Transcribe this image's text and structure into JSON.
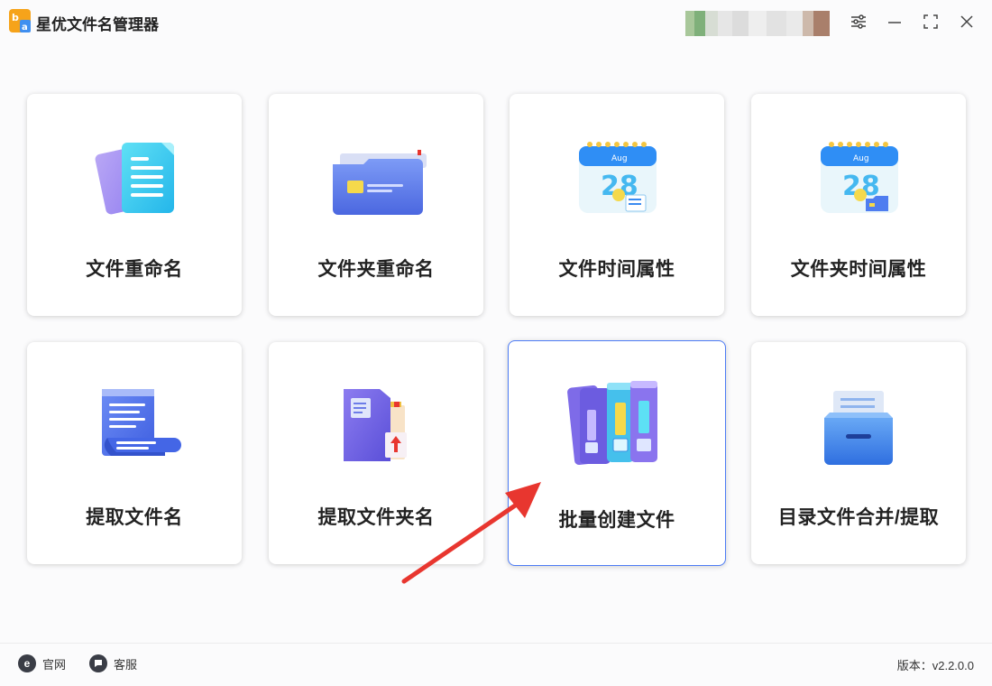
{
  "app": {
    "title": "星优文件名管理器",
    "logo_icon": "app-logo-icon"
  },
  "window_controls": {
    "settings_icon": "sliders-icon",
    "minimize_icon": "minimize-icon",
    "maximize_icon": "maximize-icon",
    "close_icon": "close-icon"
  },
  "cards": [
    {
      "label": "文件重命名",
      "icon": "document-stack-icon"
    },
    {
      "label": "文件夹重命名",
      "icon": "folder-icon"
    },
    {
      "label": "文件时间属性",
      "icon": "calendar-icon"
    },
    {
      "label": "文件夹时间属性",
      "icon": "calendar-folder-icon"
    },
    {
      "label": "提取文件名",
      "icon": "scroll-document-icon"
    },
    {
      "label": "提取文件夹名",
      "icon": "folder-book-icon"
    },
    {
      "label": "批量创建文件",
      "icon": "binders-icon",
      "active": true
    },
    {
      "label": "目录文件合并/提取",
      "icon": "file-drawer-icon"
    }
  ],
  "calendar": {
    "month": "Aug",
    "day": "28"
  },
  "footer": {
    "website_label": "官网",
    "support_label": "客服",
    "version_text": "版本：v2.2.0.0"
  },
  "colors": {
    "accent": "#4d7cf5",
    "arrow": "#e8362f"
  }
}
